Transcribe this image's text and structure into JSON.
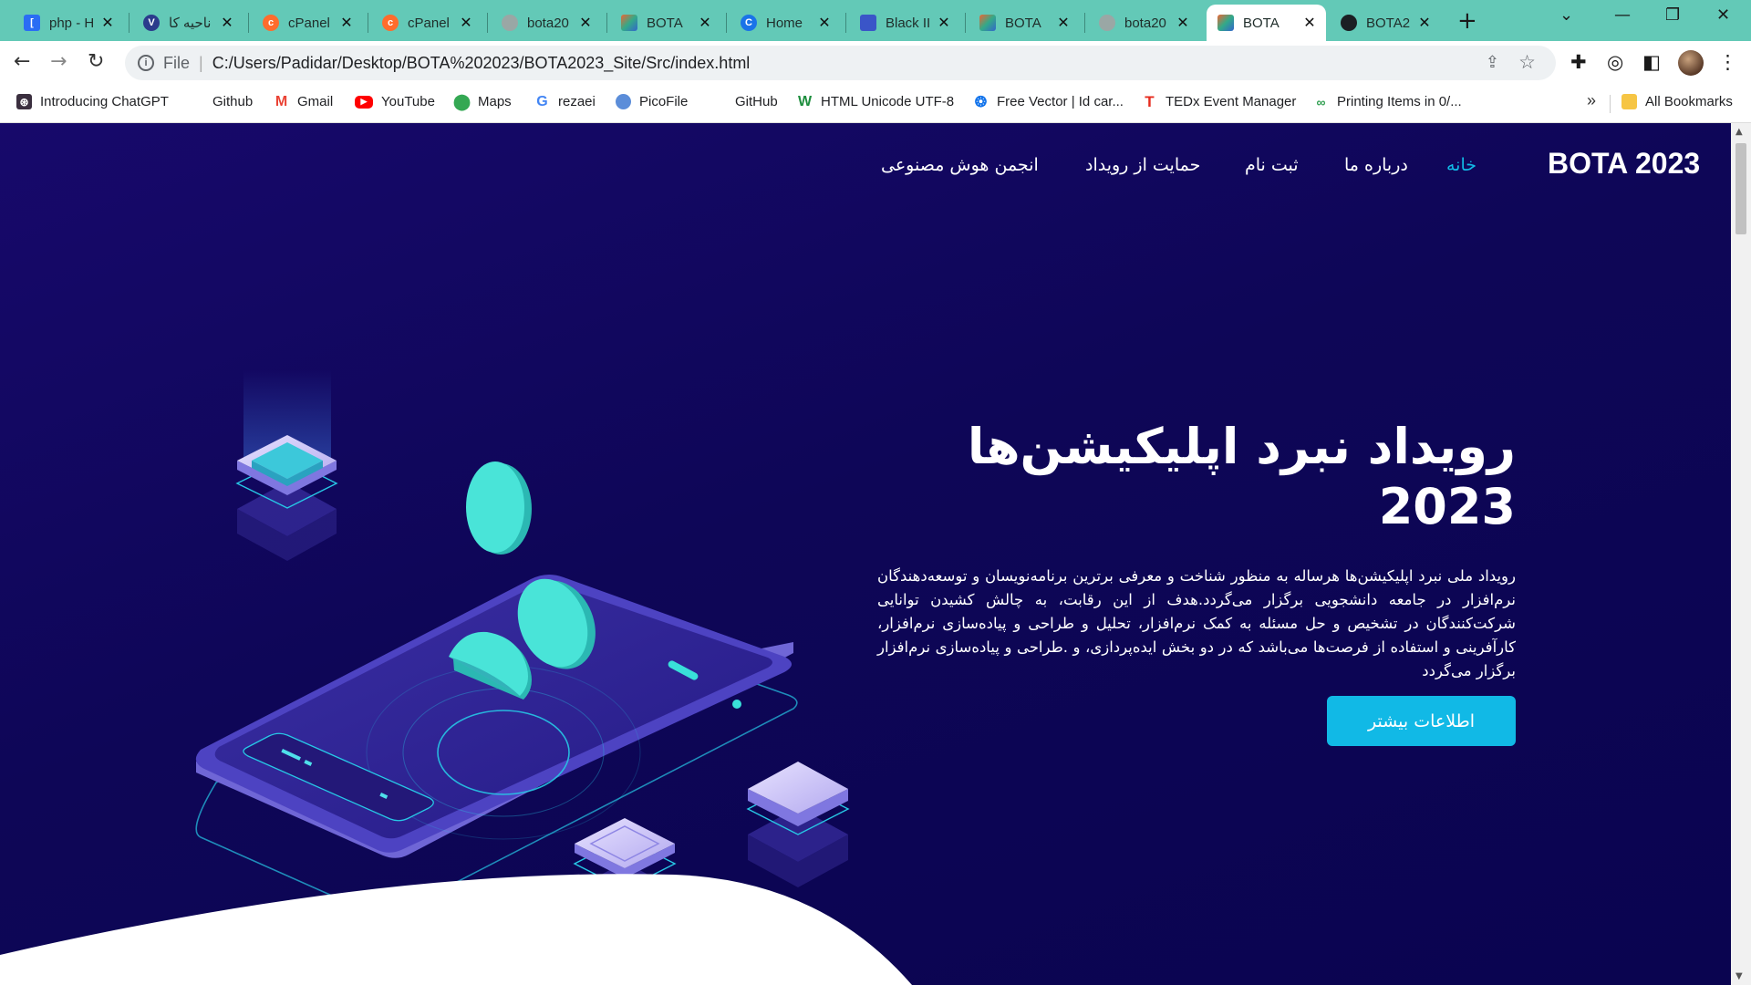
{
  "browser": {
    "tabs": [
      {
        "title": "php - H",
        "icon": "php-doc-icon"
      },
      {
        "title": "ناحیه کا",
        "icon": "vivaldi-icon"
      },
      {
        "title": "cPanel",
        "icon": "cpanel-icon"
      },
      {
        "title": "cPanel",
        "icon": "cpanel-icon"
      },
      {
        "title": "bota20",
        "icon": "globe-icon"
      },
      {
        "title": "BOTA",
        "icon": "bota-icon"
      },
      {
        "title": "Home",
        "icon": "home-c-icon"
      },
      {
        "title": "Black II",
        "icon": "printer-icon"
      },
      {
        "title": "BOTA",
        "icon": "bota-icon"
      },
      {
        "title": "bota20",
        "icon": "globe-icon"
      },
      {
        "title": "BOTA",
        "icon": "bota-icon"
      },
      {
        "title": "BOTA2",
        "icon": "github-icon"
      }
    ],
    "active_tab_index": 10,
    "new_tab": "+",
    "url_scheme_label": "File",
    "url": "C:/Users/Padidar/Desktop/BOTA%202023/BOTA2023_Site/Src/index.html",
    "bookmarks": [
      {
        "label": "Introducing ChatGPT",
        "icon": "chatgpt-icon"
      },
      {
        "label": "Github",
        "icon": "github-icon"
      },
      {
        "label": "Gmail",
        "icon": "gmail-icon"
      },
      {
        "label": "YouTube",
        "icon": "youtube-icon"
      },
      {
        "label": "Maps",
        "icon": "maps-icon"
      },
      {
        "label": "rezaei",
        "icon": "google-icon"
      },
      {
        "label": "PicoFile",
        "icon": "picofile-icon"
      },
      {
        "label": "GitHub",
        "icon": "github-icon"
      },
      {
        "label": "HTML Unicode UTF-8",
        "icon": "w-icon"
      },
      {
        "label": "Free Vector | Id car...",
        "icon": "freepik-icon"
      },
      {
        "label": "TEDx Event Manager",
        "icon": "tedx-icon"
      },
      {
        "label": "Printing Items in 0/...",
        "icon": "printing-icon"
      }
    ],
    "bookmarks_overflow": "»",
    "all_bookmarks": "All Bookmarks"
  },
  "site": {
    "logo": "BOTA 2023",
    "nav": {
      "home": "خانه",
      "about": "درباره ما",
      "register": "ثبت نام",
      "support": "حمایت از رویداد",
      "ai_society": "انجمن هوش مصنوعی"
    },
    "hero": {
      "title_line1": "رویداد نبرد اپلیکیشن‌ها",
      "title_line2": "2023",
      "description": "رویداد ملی نبرد اپلیکیشن‌ها هرساله به منظور شناخت و معرفی برترین برنامه‌نویسان و توسعه‌دهندگان نرم‌افزار در جامعه دانشجویی برگزار می‌گردد.هدف از این رقابت، به چالش کشیدن توانایی شرکت‌کنندگان در تشخیص و حل مسئله به کمک نرم‌افزار، تحلیل و طراحی و پیاده‌سازی نرم‌افزار، کارآفرینی و استفاده از فرصت‌ها می‌باشد که در دو بخش ایده‌پردازی، و .طراحی و پیاده‌سازی نرم‌افزار برگزار می‌گردد",
      "cta": "اطلاعات بیشتر"
    },
    "colors": {
      "background": "#0e0657",
      "accent": "#11b9e6",
      "tab_strip": "#63c9b7"
    }
  }
}
